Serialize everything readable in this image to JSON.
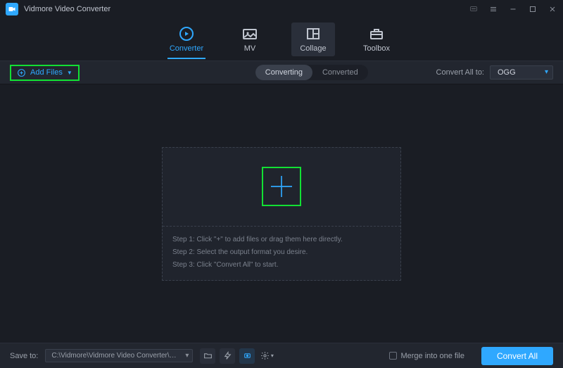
{
  "app": {
    "title": "Vidmore Video Converter"
  },
  "tabs": {
    "converter": "Converter",
    "mv": "MV",
    "collage": "Collage",
    "toolbox": "Toolbox"
  },
  "subbar": {
    "add_files": "Add Files",
    "converting": "Converting",
    "converted": "Converted",
    "convert_all_to_label": "Convert All to:",
    "format": "OGG"
  },
  "dropzone": {
    "step1": "Step 1: Click \"+\" to add files or drag them here directly.",
    "step2": "Step 2: Select the output format you desire.",
    "step3": "Step 3: Click \"Convert All\" to start."
  },
  "bottom": {
    "save_to_label": "Save to:",
    "save_path": "C:\\Vidmore\\Vidmore Video Converter\\Converted",
    "merge_label": "Merge into one file",
    "convert_all": "Convert All"
  }
}
